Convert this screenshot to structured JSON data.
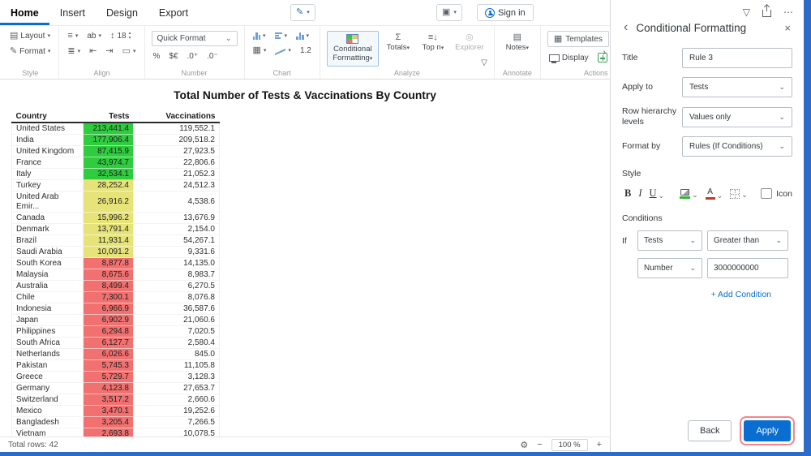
{
  "icons": {
    "pen": "✎",
    "window": "▣",
    "chevron_down": "▾",
    "select_chevron": "⌄",
    "layout": "▤",
    "format_brush": "✎",
    "align_text": "≡",
    "align_vertical": "≣",
    "indent_left": "⇤",
    "indent_right": "⇥",
    "merge_cells": "▭",
    "font_resize": "↕",
    "spin_up": "▴",
    "spin_down": "▾",
    "grid": "▦",
    "sigma": "Σ",
    "top_n": "≡↓",
    "explorer": "◎",
    "notes": "▤",
    "templates": "▦",
    "undo": "↺",
    "redo": "↻",
    "expand_more": "›",
    "funnel": "▽",
    "gear": "⚙",
    "minus": "−",
    "plus": "+",
    "ellipsis": "⋯",
    "back_chevron": "‹",
    "close": "×"
  },
  "topbar": {
    "tabs": [
      {
        "label": "Home"
      },
      {
        "label": "Insert"
      },
      {
        "label": "Design"
      },
      {
        "label": "Export"
      }
    ],
    "sign_in": "Sign in"
  },
  "ribbon": {
    "style": {
      "group": "Style",
      "layout": "Layout",
      "format": "Format"
    },
    "align": {
      "group": "Align",
      "wrap": "ab",
      "font_size": "18"
    },
    "number": {
      "group": "Number",
      "quick_format": "Quick Format",
      "percent": "%",
      "currency": "$€",
      "increase_decimal": ".0⁺",
      "decrease_decimal": ".0⁻"
    },
    "chart": {
      "group": "Chart",
      "decimal": "1.2"
    },
    "analyze": {
      "group": "Analyze",
      "conditional_formatting": "Conditional Formatting",
      "totals": "Totals",
      "top_n": "Top n",
      "explorer": "Explorer"
    },
    "annotate": {
      "group": "Annotate",
      "notes": "Notes"
    },
    "actions": {
      "group": "Actions",
      "templates": "Templates",
      "display": "Display"
    }
  },
  "report": {
    "title": "Total Number of Tests & Vaccinations By Country"
  },
  "table": {
    "columns": [
      "Country",
      "Tests",
      "Vaccinations"
    ],
    "rows": [
      {
        "country": "United States",
        "tests": "213,441.4",
        "level": "green",
        "vaccinations": "119,552.1"
      },
      {
        "country": "India",
        "tests": "177,906.4",
        "level": "green",
        "vaccinations": "209,518.2"
      },
      {
        "country": "United Kingdom",
        "tests": "87,415.9",
        "level": "green",
        "vaccinations": "27,923.5"
      },
      {
        "country": "France",
        "tests": "43,974.7",
        "level": "green",
        "vaccinations": "22,806.6"
      },
      {
        "country": "Italy",
        "tests": "32,534.1",
        "level": "green",
        "vaccinations": "21,052.3"
      },
      {
        "country": "Turkey",
        "tests": "28,252.4",
        "level": "yellow",
        "vaccinations": "24,512.3"
      },
      {
        "country": "United Arab Emir...",
        "tests": "26,916.2",
        "level": "yellow",
        "vaccinations": "4,538.6"
      },
      {
        "country": "Canada",
        "tests": "15,996.2",
        "level": "yellow",
        "vaccinations": "13,676.9"
      },
      {
        "country": "Denmark",
        "tests": "13,791.4",
        "level": "yellow",
        "vaccinations": "2,154.0"
      },
      {
        "country": "Brazil",
        "tests": "11,931.4",
        "level": "yellow",
        "vaccinations": "54,267.1"
      },
      {
        "country": "Saudi Arabia",
        "tests": "10,091.2",
        "level": "yellow",
        "vaccinations": "9,331.6"
      },
      {
        "country": "South Korea",
        "tests": "8,877.8",
        "level": "red",
        "vaccinations": "14,135.0"
      },
      {
        "country": "Malaysia",
        "tests": "8,675.6",
        "level": "red",
        "vaccinations": "8,983.7"
      },
      {
        "country": "Australia",
        "tests": "8,499.4",
        "level": "red",
        "vaccinations": "6,270.5"
      },
      {
        "country": "Chile",
        "tests": "7,300.1",
        "level": "red",
        "vaccinations": "8,076.8"
      },
      {
        "country": "Indonesia",
        "tests": "6,966.9",
        "level": "red",
        "vaccinations": "36,587.6"
      },
      {
        "country": "Japan",
        "tests": "6,902.9",
        "level": "red",
        "vaccinations": "21,060.6"
      },
      {
        "country": "Philippines",
        "tests": "6,294.8",
        "level": "red",
        "vaccinations": "7,020.5"
      },
      {
        "country": "South Africa",
        "tests": "6,127.7",
        "level": "red",
        "vaccinations": "2,580.4"
      },
      {
        "country": "Netherlands",
        "tests": "6,026.6",
        "level": "red",
        "vaccinations": "845.0"
      },
      {
        "country": "Pakistan",
        "tests": "5,745.3",
        "level": "red",
        "vaccinations": "11,105.8"
      },
      {
        "country": "Greece",
        "tests": "5,729.7",
        "level": "red",
        "vaccinations": "3,128.3"
      },
      {
        "country": "Germany",
        "tests": "4,123.8",
        "level": "red",
        "vaccinations": "27,653.7"
      },
      {
        "country": "Switzerland",
        "tests": "3,517.2",
        "level": "red",
        "vaccinations": "2,660.6"
      },
      {
        "country": "Mexico",
        "tests": "3,470.1",
        "level": "red",
        "vaccinations": "19,252.6"
      },
      {
        "country": "Bangladesh",
        "tests": "3,205.4",
        "level": "red",
        "vaccinations": "7,266.5"
      },
      {
        "country": "Vietnam",
        "tests": "2,693.8",
        "level": "red",
        "vaccinations": "10,078.5"
      }
    ]
  },
  "statusbar": {
    "total_rows": "Total rows: 42",
    "zoom": "100 %"
  },
  "panel": {
    "title": "Conditional Formatting",
    "title_label": "Title",
    "title_value": "Rule 3",
    "apply_to_label": "Apply to",
    "apply_to_value": "Tests",
    "row_hierarchy_label": "Row hierarchy levels",
    "row_hierarchy_value": "Values only",
    "format_by_label": "Format by",
    "format_by_value": "Rules (If Conditions)",
    "style_section": "Style",
    "bold": "B",
    "italic": "I",
    "underline": "U",
    "font_color": "A",
    "icon_checkbox": "Icon",
    "conditions_section": "Conditions",
    "if_label": "If",
    "condition_field": "Tests",
    "condition_operator": "Greater than",
    "condition_value_type": "Number",
    "condition_value": "3000000000",
    "add_condition": "+ Add Condition",
    "back": "Back",
    "apply": "Apply"
  },
  "colors": {
    "accent": "#0a6ed1",
    "green": "#2ecc3e",
    "yellow": "#e6e478",
    "red": "#f17070",
    "apply_highlight": "#f4858d"
  }
}
